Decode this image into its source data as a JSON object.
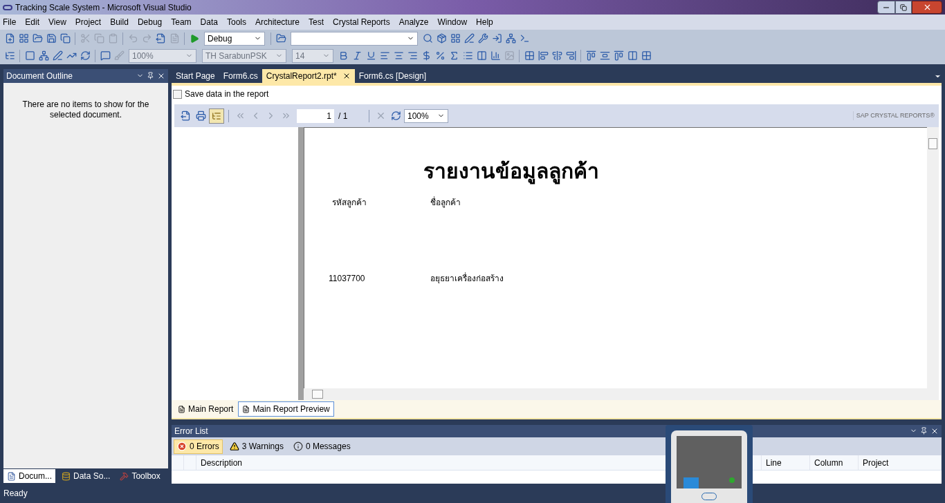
{
  "window": {
    "title": "Tracking Scale System - Microsoft Visual Studio"
  },
  "menu": [
    "File",
    "Edit",
    "View",
    "Project",
    "Build",
    "Debug",
    "Team",
    "Data",
    "Tools",
    "Architecture",
    "Test",
    "Crystal Reports",
    "Analyze",
    "Window",
    "Help"
  ],
  "toolbar": {
    "configuration": "Debug",
    "zoom": "100%",
    "font": "TH SarabunPSK",
    "font_size": "14"
  },
  "document_outline": {
    "title": "Document Outline",
    "message": "There are no items to show for the selected document.",
    "tabs": [
      {
        "label": "Docum...",
        "selected": true
      },
      {
        "label": "Data So...",
        "selected": false
      },
      {
        "label": "Toolbox",
        "selected": false
      }
    ]
  },
  "editor_tabs": [
    {
      "label": "Start Page",
      "selected": false
    },
    {
      "label": "Form6.cs",
      "selected": false
    },
    {
      "label": "CrystalReport2.rpt*",
      "selected": true
    },
    {
      "label": "Form6.cs [Design]",
      "selected": false
    }
  ],
  "save_data": {
    "label": "Save data in the report",
    "checked": false
  },
  "viewer": {
    "page": "1",
    "total": "/ 1",
    "zoom": "100%",
    "brand": "SAP CRYSTAL REPORTS®"
  },
  "report": {
    "title": "รายงานข้อมูลลูกค้า",
    "columns": [
      "รหัสลูกค้า",
      "ชื่อลูกค้า"
    ],
    "rows": [
      [
        "11037700",
        "อยุธยาเครื่องก่อสร้าง"
      ]
    ]
  },
  "view_tabs": [
    {
      "label": "Main Report",
      "selected": false
    },
    {
      "label": "Main Report Preview",
      "selected": true
    }
  ],
  "error_list": {
    "title": "Error List",
    "filters": [
      {
        "kind": "error",
        "label": "0 Errors",
        "selected": true
      },
      {
        "kind": "warning",
        "label": "3 Warnings",
        "selected": false
      },
      {
        "kind": "info",
        "label": "0 Messages",
        "selected": false
      }
    ],
    "columns": [
      "Description",
      "Line",
      "Column",
      "Project"
    ]
  },
  "status_bar": "Ready"
}
